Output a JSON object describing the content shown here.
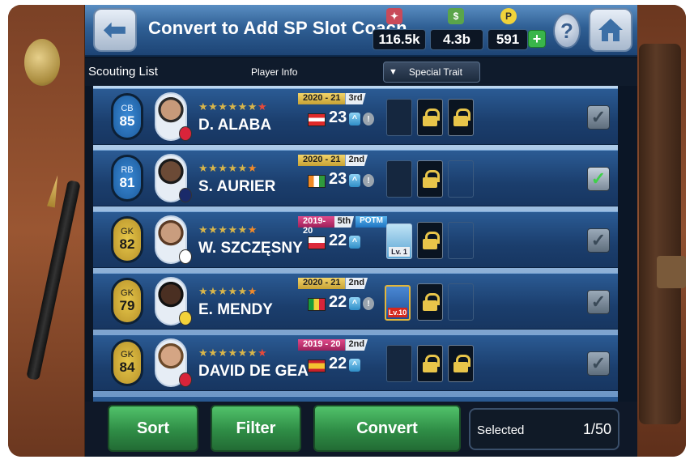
{
  "header": {
    "title": "Convert to Add SP Slot Coach",
    "currencies": [
      {
        "name": "gp",
        "value": "116.5k"
      },
      {
        "name": "cash",
        "value": "4.3b"
      },
      {
        "name": "myclub-coins",
        "value": "591"
      }
    ],
    "coin_label": "P"
  },
  "subbar": {
    "scouting_label": "Scouting List",
    "player_info_label": "Player Info",
    "trait_dropdown": "Special Trait"
  },
  "players": [
    {
      "position": "CB",
      "rating": "85",
      "name": "D. ALABA",
      "season": "2020 - 21",
      "rank": "3rd",
      "age": "23",
      "checked": false
    },
    {
      "position": "RB",
      "rating": "81",
      "name": "S. AURIER",
      "season": "2020 - 21",
      "rank": "2nd",
      "age": "23",
      "checked": true
    },
    {
      "position": "GK",
      "rating": "82",
      "name": "W. SZCZĘSNY",
      "season": "2019-20",
      "rank": "5th",
      "extra": "POTM",
      "age": "22",
      "skill_level": "Lv. 1",
      "checked": false
    },
    {
      "position": "GK",
      "rating": "79",
      "name": "E. MENDY",
      "season": "2020 - 21",
      "rank": "2nd",
      "age": "22",
      "skill_level": "Lv.10",
      "checked": false
    },
    {
      "position": "GK",
      "rating": "84",
      "name": "DAVID DE GEA",
      "season": "2019 - 20",
      "rank": "2nd",
      "age": "22",
      "checked": false
    }
  ],
  "footer": {
    "sort": "Sort",
    "filter": "Filter",
    "convert": "Convert",
    "selected_label": "Selected",
    "selected_value": "1/50"
  },
  "colors": {
    "accent_green": "#2f8d46",
    "header_blue": "#2f5f94",
    "badge_blue": "#2a78c8",
    "badge_gold": "#d9b43a"
  }
}
